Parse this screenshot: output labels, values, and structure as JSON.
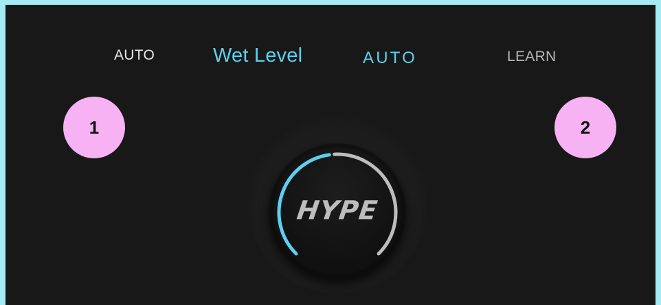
{
  "controls": {
    "auto_left_label": "AUTO",
    "parameter_label": "Wet Level",
    "auto_right_label": "AUTO",
    "learn_label": "LEARN"
  },
  "annotations": {
    "badge_1": "1",
    "badge_2": "2"
  },
  "knob": {
    "logo_text": "HYPE",
    "value_fraction": 0.48,
    "colors": {
      "active_arc": "#5cd1ef",
      "inactive_arc": "#bdbdbd",
      "label_accent": "#5cd1ef",
      "badge": "#f7b2f3"
    }
  }
}
